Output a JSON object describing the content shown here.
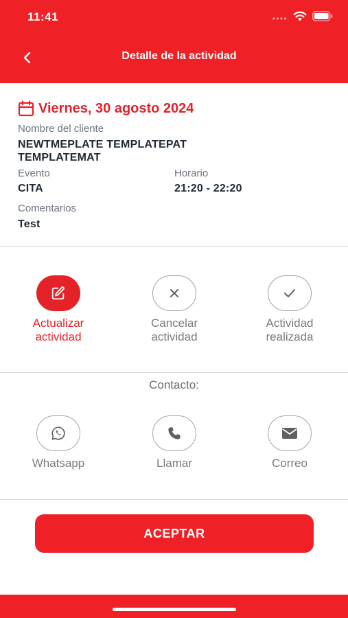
{
  "status_bar": {
    "time": "11:41"
  },
  "header": {
    "title": "Detalle de la actividad"
  },
  "activity": {
    "date": "Viernes, 30 agosto 2024",
    "client_label": "Nombre del cliente",
    "client_name": "NEWTMEPLATE TEMPLATEPAT TEMPLATEMAT",
    "event_label": "Evento",
    "event_value": "CITA",
    "schedule_label": "Horario",
    "schedule_value": "21:20 - 22:20",
    "comments_label": "Comentarios",
    "comments_value": "Test"
  },
  "actions": [
    {
      "line1": "Actualizar",
      "line2": "actividad",
      "icon": "edit-icon"
    },
    {
      "line1": "Cancelar",
      "line2": "actividad",
      "icon": "close-icon"
    },
    {
      "line1": "Actividad",
      "line2": "realizada",
      "icon": "check-icon"
    }
  ],
  "contact": {
    "title": "Contacto:",
    "items": [
      {
        "label": "Whatsapp",
        "icon": "whatsapp-icon"
      },
      {
        "label": "Llamar",
        "icon": "phone-icon"
      },
      {
        "label": "Correo",
        "icon": "mail-icon"
      }
    ]
  },
  "accept_button": {
    "label": "ACEPTAR"
  },
  "colors": {
    "brand": "#ef2127",
    "accent_text": "#e52228",
    "muted": "#7a7a7a"
  }
}
